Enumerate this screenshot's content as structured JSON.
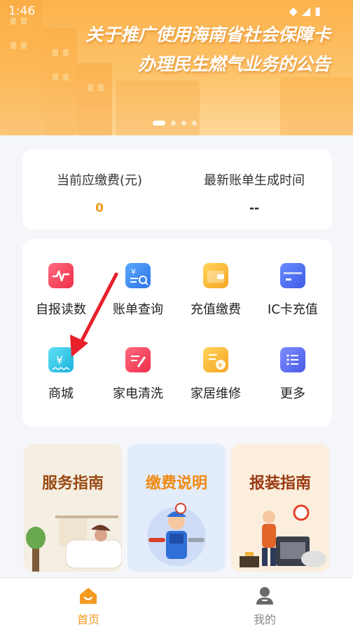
{
  "status_bar": {
    "time": "1:46",
    "icons": [
      "wifi-icon",
      "signal-icon",
      "battery-icon"
    ]
  },
  "banner": {
    "line1": "关于推广使用海南省社会保障卡",
    "line2": "办理民生燃气业务的公告",
    "slides": 4,
    "active_slide": 1
  },
  "bill": {
    "due_label": "当前应缴费(元)",
    "due_value": "0",
    "latest_label": "最新账单生成时间",
    "latest_value": "--"
  },
  "menu": {
    "items": [
      {
        "label": "自报读数",
        "icon": "meter-reading-icon",
        "color": "#f2435a"
      },
      {
        "label": "账单查询",
        "icon": "bill-search-icon",
        "color": "#3f8ef0"
      },
      {
        "label": "充值缴费",
        "icon": "wallet-icon",
        "color": "#f7b726"
      },
      {
        "label": "IC卡充值",
        "icon": "card-icon",
        "color": "#4b6ff0"
      },
      {
        "label": "商城",
        "icon": "receipt-yen-icon",
        "color": "#26c3e6"
      },
      {
        "label": "家电清洗",
        "icon": "note-edit-icon",
        "color": "#f04a5c"
      },
      {
        "label": "家居维修",
        "icon": "repair-doc-icon",
        "color": "#f7b726"
      },
      {
        "label": "更多",
        "icon": "more-list-icon",
        "color": "#5b6cf2"
      }
    ]
  },
  "guides": [
    {
      "title": "服务指南",
      "bg": "#f4eee3",
      "color": "#9a4a12"
    },
    {
      "title": "缴费说明",
      "bg": "#e3ecfb",
      "color": "#f08a12"
    },
    {
      "title": "报装指南",
      "bg": "#fbeedd",
      "color": "#9a3a12"
    }
  ],
  "nav": {
    "home_label": "首页",
    "mine_label": "我的",
    "active_color": "#f39a1f",
    "inactive_color": "#888888"
  }
}
